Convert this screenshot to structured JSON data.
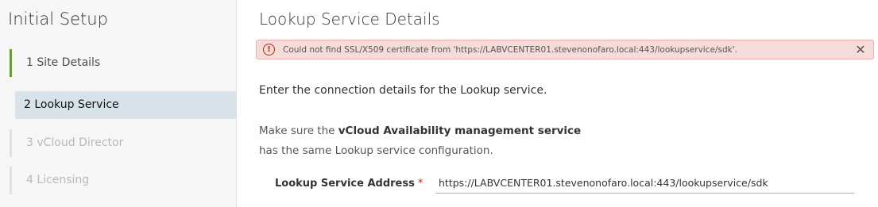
{
  "sidebar": {
    "title": "Initial Setup",
    "steps": [
      {
        "label": "1 Site Details",
        "state": "done"
      },
      {
        "label": "2 Lookup Service",
        "state": "active"
      },
      {
        "label": "3 vCloud Director",
        "state": "disabled"
      },
      {
        "label": "4 Licensing",
        "state": "disabled"
      }
    ]
  },
  "main": {
    "title": "Lookup Service Details",
    "alert": {
      "icon": "error-circle-icon",
      "message": "Could not find SSL/X509 certificate from 'https://LABVCENTER01.stevenonofaro.local:443/lookupservice/sdk'.",
      "close_icon": "close-icon"
    },
    "intro": "Enter the connection details for the Lookup service.",
    "note": {
      "prefix": "Make sure the ",
      "bold": "vCloud Availability management service",
      "line2": "has the same Lookup service configuration."
    },
    "field": {
      "label": "Lookup Service Address",
      "required_mark": "*",
      "value": "https://LABVCENTER01.stevenonofaro.local:443/lookupservice/sdk"
    }
  },
  "colors": {
    "done": "#62a420",
    "active_bg": "#d8e3e9",
    "alert_bg": "#f5dbd9",
    "error": "#c92100"
  }
}
